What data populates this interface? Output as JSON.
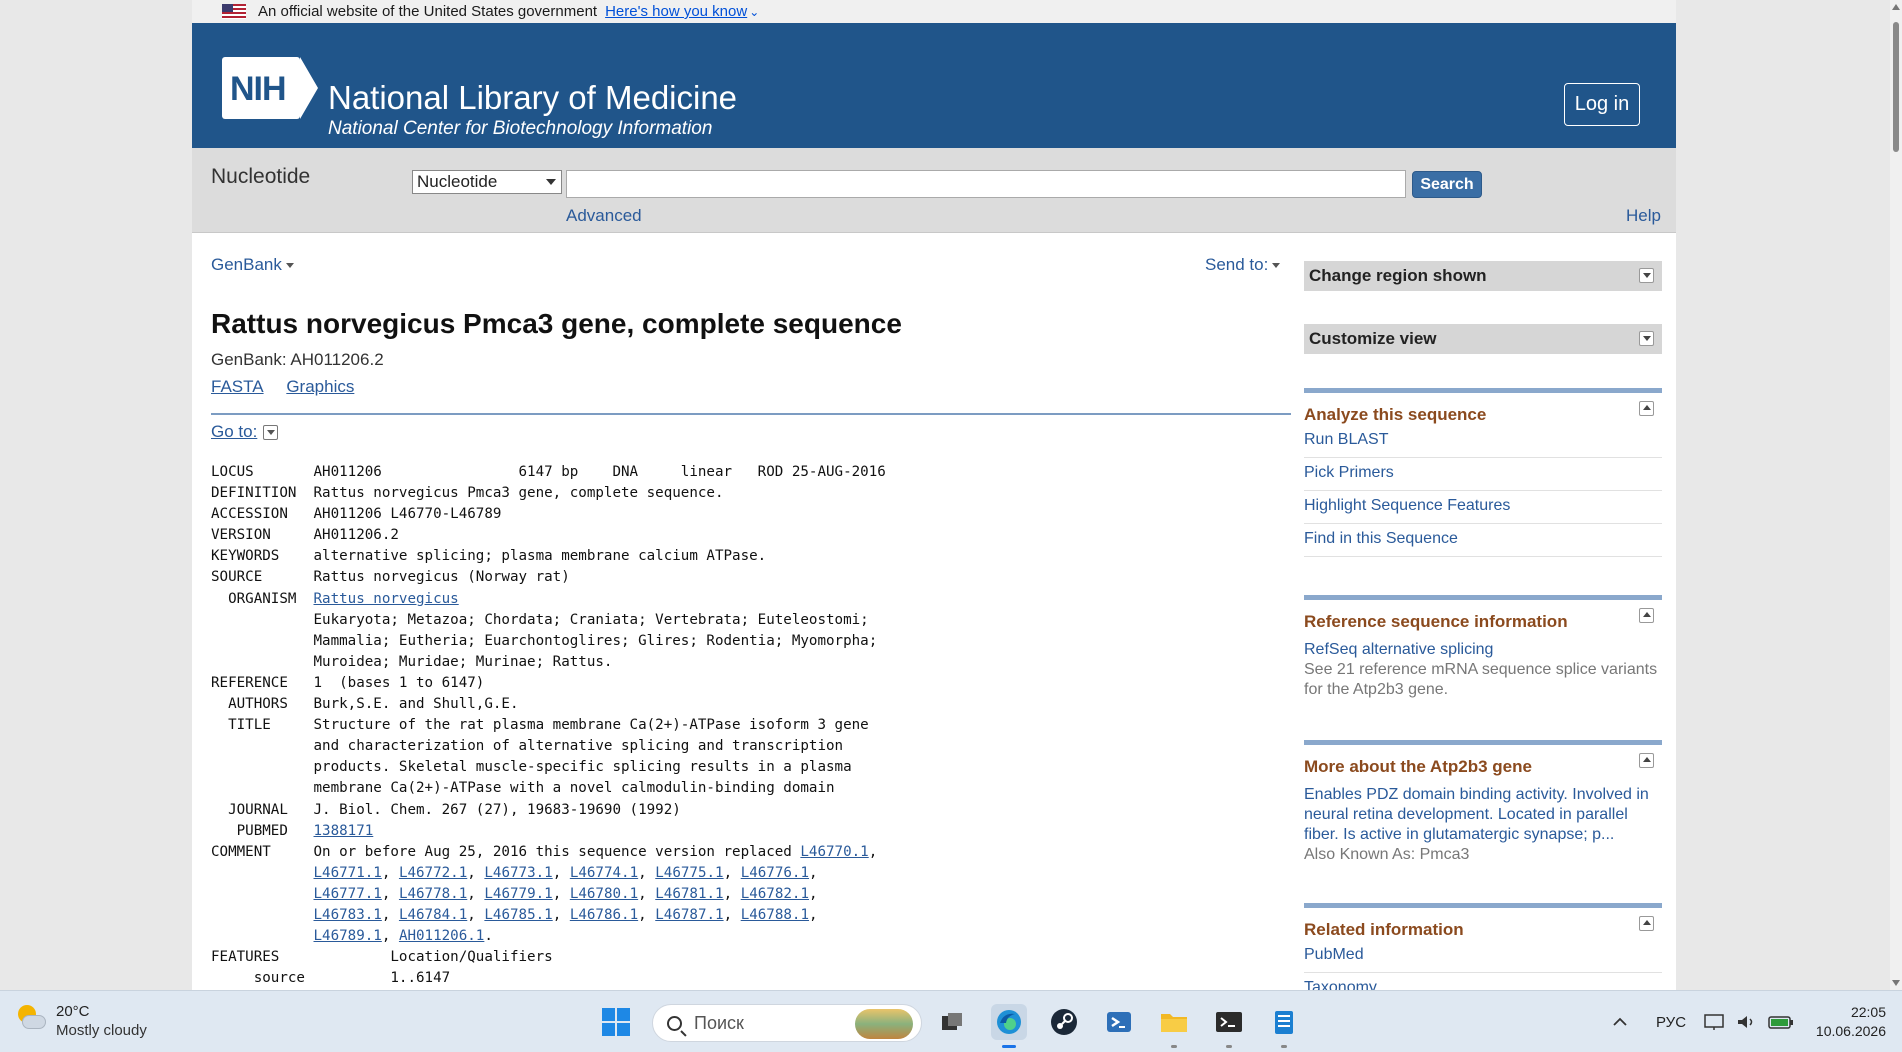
{
  "gov_banner": {
    "text": "An official website of the United States government",
    "link": "Here's how you know"
  },
  "header": {
    "logo_text": "NIH",
    "title": "National Library of Medicine",
    "subtitle": "National Center for Biotechnology Information",
    "login": "Log in"
  },
  "search": {
    "db_title": "Nucleotide",
    "db_selected": "Nucleotide",
    "query": "",
    "button": "Search",
    "advanced": "Advanced",
    "help": "Help"
  },
  "record": {
    "format": "GenBank",
    "send_to": "Send to:",
    "title": "Rattus norvegicus Pmca3 gene, complete sequence",
    "accession_line": "GenBank: AH011206.2",
    "links": [
      "FASTA",
      "Graphics"
    ],
    "goto": "Go to:"
  },
  "genbank": {
    "locus": "LOCUS       AH011206                6147 bp    DNA     linear   ROD 25-AUG-2016",
    "definition": "DEFINITION  Rattus norvegicus Pmca3 gene, complete sequence.",
    "accession": "ACCESSION   AH011206 L46770-L46789",
    "version": "VERSION     AH011206.2",
    "keywords": "KEYWORDS    alternative splicing; plasma membrane calcium ATPase.",
    "source": "SOURCE      Rattus norvegicus (Norway rat)",
    "organism_label": "  ORGANISM  ",
    "organism_link": "Rattus norvegicus",
    "lineage": [
      "            Eukaryota; Metazoa; Chordata; Craniata; Vertebrata; Euteleostomi;",
      "            Mammalia; Eutheria; Euarchontoglires; Glires; Rodentia; Myomorpha;",
      "            Muroidea; Muridae; Murinae; Rattus."
    ],
    "reference": "REFERENCE   1  (bases 1 to 6147)",
    "authors": "  AUTHORS   Burk,S.E. and Shull,G.E.",
    "title_lines": [
      "  TITLE     Structure of the rat plasma membrane Ca(2+)-ATPase isoform 3 gene",
      "            and characterization of alternative splicing and transcription",
      "            products. Skeletal muscle-specific splicing results in a plasma",
      "            membrane Ca(2+)-ATPase with a novel calmodulin-binding domain"
    ],
    "journal": "  JOURNAL   J. Biol. Chem. 267 (27), 19683-19690 (1992)",
    "pubmed_label": "   PUBMED   ",
    "pubmed_link": "1388171",
    "comment_label": "COMMENT     ",
    "comment_text": "On or before Aug 25, 2016 this sequence version replaced ",
    "comment_links": [
      "L46770.1",
      "L46771.1",
      "L46772.1",
      "L46773.1",
      "L46774.1",
      "L46775.1",
      "L46776.1",
      "L46777.1",
      "L46778.1",
      "L46779.1",
      "L46780.1",
      "L46781.1",
      "L46782.1",
      "L46783.1",
      "L46784.1",
      "L46785.1",
      "L46786.1",
      "L46787.1",
      "L46788.1",
      "L46789.1",
      "AH011206.1"
    ],
    "features": "FEATURES             Location/Qualifiers",
    "source_feature": "     source          1..6147"
  },
  "sidebar": {
    "change_region": "Change region shown",
    "customize": "Customize view",
    "analyze": {
      "title": "Analyze this sequence",
      "items": [
        "Run BLAST",
        "Pick Primers",
        "Highlight Sequence Features",
        "Find in this Sequence"
      ]
    },
    "refseq": {
      "title": "Reference sequence information",
      "link": "RefSeq alternative splicing",
      "desc": "See 21 reference mRNA sequence splice variants for the Atp2b3 gene."
    },
    "gene": {
      "title": "More about the Atp2b3 gene",
      "link": "Enables PDZ domain binding activity. Involved in neural retina development. Located in parallel fiber. Is active in glutamatergic synapse; p...",
      "aka": "Also Known As: Pmca3"
    },
    "related": {
      "title": "Related information",
      "items": [
        "PubMed",
        "Taxonomy"
      ]
    }
  },
  "taskbar": {
    "temp": "20°C",
    "condition": "Mostly cloudy",
    "search_placeholder": "Поиск",
    "lang": "РУС",
    "time": "22:05",
    "date": "10.06.2026"
  }
}
